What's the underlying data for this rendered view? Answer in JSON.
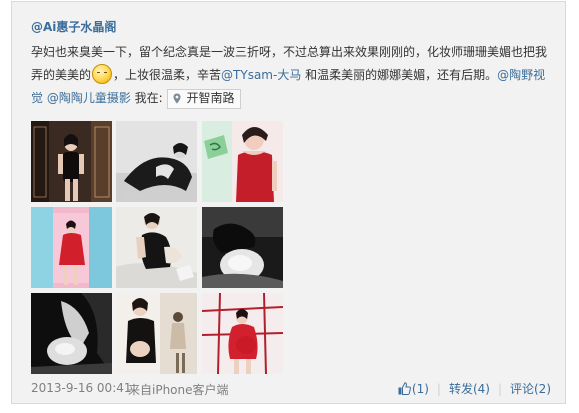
{
  "post": {
    "author": "@Ai惠子水晶阁",
    "text_1": "孕妇也来臭美一下，留个纪念真是一波三折呀，不过总算出来效果刚刚的，化妆师珊珊美媚也把我弄的美美的",
    "text_2": "，上妆很温柔，辛苦",
    "mention_1": "@TYsam-大马",
    "text_3": " 和温柔美丽的娜娜美媚，还有后期。",
    "mention_2": "@陶野视觉",
    "text_4": " ",
    "mention_3": "@陶陶儿童摄影",
    "text_5": " 我在:",
    "location": "开智南路",
    "emoji_name": "smile-emoji"
  },
  "footer": {
    "date": "2013-9-16 00:41",
    "source": "来自iPhone客户端",
    "like": "(1)",
    "repost": "转发(4)",
    "comment": "评论(2)"
  },
  "colors": {
    "link": "#3b6d9a",
    "meta": "#808080",
    "card_bg": "#f2f2f2"
  }
}
